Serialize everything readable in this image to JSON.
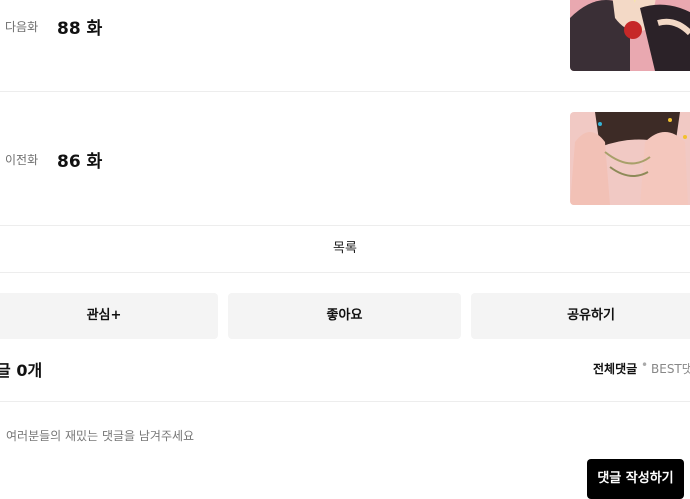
{
  "episodes": {
    "next": {
      "kind_label": "다음화",
      "episode": "88 화"
    },
    "prev": {
      "kind_label": "이전화",
      "episode": "86 화"
    }
  },
  "list_label": "목록",
  "actions": {
    "subscribe": "관심+",
    "like": "좋아요",
    "share": "공유하기"
  },
  "comments": {
    "title_prefix": "글",
    "count": "0개",
    "sort_all": "전체댓글",
    "sort_separator": "•",
    "sort_best": "BEST댓",
    "input_placeholder": "여러분들의 재밌는 댓글을 남겨주세요",
    "write_button": "댓글 작성하기"
  },
  "colors": {
    "accent": "#000000",
    "muted": "#6f6f6f",
    "button_bg": "#f4f4f4",
    "divider": "#ededed"
  }
}
